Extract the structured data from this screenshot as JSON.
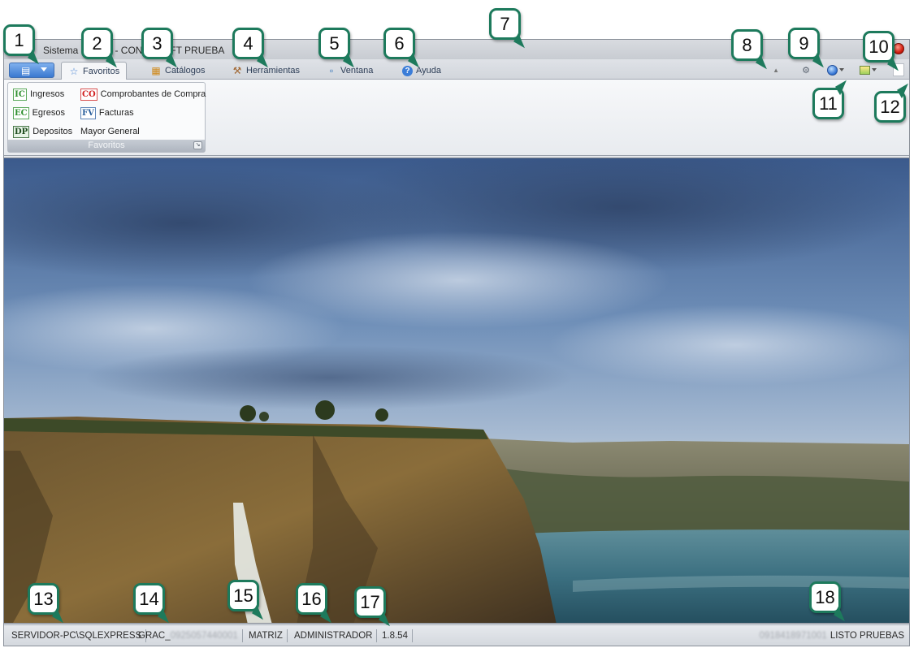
{
  "window": {
    "title": "Sistema LSOFT - CONTOSOFT PRUEBA"
  },
  "app_menu": {
    "icon": "application-menu-icon"
  },
  "tabs": [
    {
      "label": "Favoritos",
      "icon": "star-icon",
      "active": true
    },
    {
      "label": "Catálogos",
      "icon": "catalog-icon",
      "active": false
    },
    {
      "label": "Herramientas",
      "icon": "tools-icon",
      "active": false
    },
    {
      "label": "Ventana",
      "icon": "window-icon",
      "active": false
    },
    {
      "label": "Ayuda",
      "icon": "help-icon",
      "active": false
    }
  ],
  "ribbon": {
    "group_caption": "Favoritos",
    "items": [
      {
        "badge": "IC",
        "label": "Ingresos",
        "badge_color": "#2f8f2f"
      },
      {
        "badge": "CO",
        "label": "Comprobantes de Compra",
        "badge_color": "#d12020"
      },
      {
        "badge": "EC",
        "label": "Egresos",
        "badge_color": "#2f8f2f"
      },
      {
        "badge": "FV",
        "label": "Facturas",
        "badge_color": "#2a5f9c"
      },
      {
        "badge": "DP",
        "label": "Depositos",
        "badge_color": "#1e4d1e"
      },
      {
        "badge": "",
        "label": "Mayor General",
        "badge_color": ""
      }
    ]
  },
  "status": {
    "server": "SERVIDOR-PC\\SQLEXPRESS",
    "company_prefix": "GRAC_",
    "company_blurred": "0925057440001",
    "branch": "MATRIZ",
    "user": "ADMINISTRADOR",
    "version": "1.8.54",
    "ruc_blurred": "0918418971001",
    "environment": "LISTO PRUEBAS"
  },
  "callouts": [
    "1",
    "2",
    "3",
    "4",
    "5",
    "6",
    "7",
    "8",
    "9",
    "10",
    "11",
    "12",
    "13",
    "14",
    "15",
    "16",
    "17",
    "18"
  ],
  "colors": {
    "callout_border": "#1d7a5c",
    "app_button": "#3a78d0",
    "close_button": "#d21f10"
  }
}
